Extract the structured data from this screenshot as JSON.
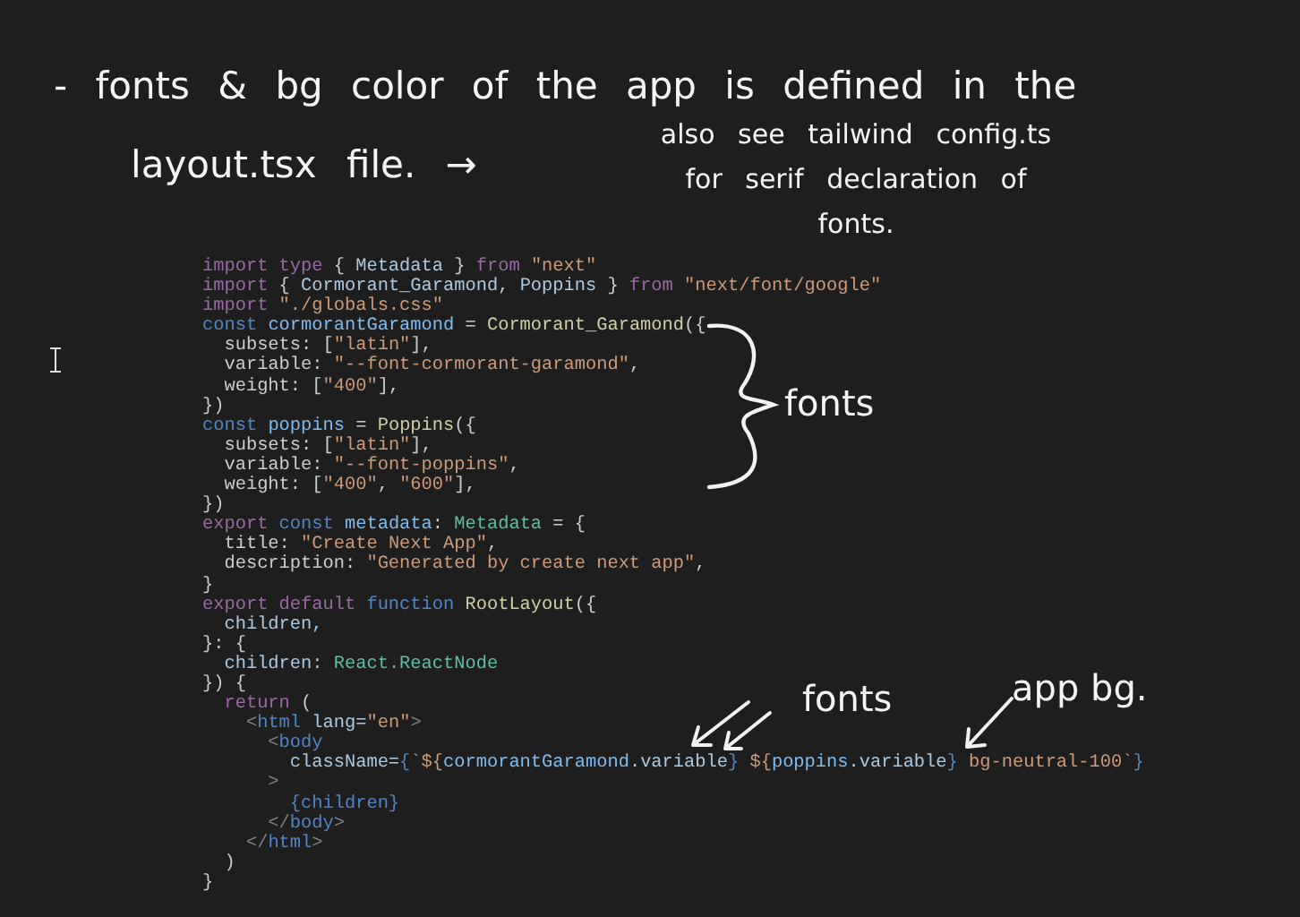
{
  "note": {
    "line1": "- fonts & bg color of the app is defined in the",
    "line2": "layout.tsx file. →",
    "aside": [
      "also see tailwind config.ts",
      "for serif declaration of",
      "fonts."
    ]
  },
  "code": {
    "lines": [
      [
        {
          "t": "import type",
          "kind": "kw"
        },
        {
          "t": " { ",
          "kind": "p"
        },
        {
          "t": "Metadata",
          "kind": "var"
        },
        {
          "t": " } ",
          "kind": "p"
        },
        {
          "t": "from",
          "kind": "kw"
        },
        {
          "t": " \"next\"",
          "kind": "str"
        }
      ],
      [
        {
          "t": "import",
          "kind": "kw"
        },
        {
          "t": " { ",
          "kind": "p"
        },
        {
          "t": "Cormorant_Garamond",
          "kind": "var"
        },
        {
          "t": ", ",
          "kind": "p"
        },
        {
          "t": "Poppins",
          "kind": "var"
        },
        {
          "t": " } ",
          "kind": "p"
        },
        {
          "t": "from",
          "kind": "kw"
        },
        {
          "t": " \"next/font/google\"",
          "kind": "str"
        }
      ],
      [
        {
          "t": "import",
          "kind": "kw"
        },
        {
          "t": " \"./globals.css\"",
          "kind": "str"
        }
      ],
      [
        {
          "t": "const",
          "kind": "decl"
        },
        {
          "t": " cormorantGaramond",
          "kind": "varb"
        },
        {
          "t": " = ",
          "kind": "p"
        },
        {
          "t": "Cormorant_Garamond",
          "kind": "fn"
        },
        {
          "t": "({",
          "kind": "p"
        }
      ],
      [
        {
          "t": "  subsets: [",
          "kind": "p"
        },
        {
          "t": "\"latin\"",
          "kind": "str"
        },
        {
          "t": "],",
          "kind": "p"
        }
      ],
      [
        {
          "t": "  variable: ",
          "kind": "p"
        },
        {
          "t": "\"--font-cormorant-garamond\"",
          "kind": "str"
        },
        {
          "t": ",",
          "kind": "p"
        }
      ],
      [
        {
          "t": "  weight: [",
          "kind": "p"
        },
        {
          "t": "\"400\"",
          "kind": "str"
        },
        {
          "t": "],",
          "kind": "p"
        }
      ],
      [
        {
          "t": "})",
          "kind": "p"
        }
      ],
      [
        {
          "t": "const",
          "kind": "decl"
        },
        {
          "t": " poppins",
          "kind": "varb"
        },
        {
          "t": " = ",
          "kind": "p"
        },
        {
          "t": "Poppins",
          "kind": "fn"
        },
        {
          "t": "({",
          "kind": "p"
        }
      ],
      [
        {
          "t": "  subsets: [",
          "kind": "p"
        },
        {
          "t": "\"latin\"",
          "kind": "str"
        },
        {
          "t": "],",
          "kind": "p"
        }
      ],
      [
        {
          "t": "  variable: ",
          "kind": "p"
        },
        {
          "t": "\"--font-poppins\"",
          "kind": "str"
        },
        {
          "t": ",",
          "kind": "p"
        }
      ],
      [
        {
          "t": "  weight: [",
          "kind": "p"
        },
        {
          "t": "\"400\"",
          "kind": "str"
        },
        {
          "t": ", ",
          "kind": "p"
        },
        {
          "t": "\"600\"",
          "kind": "str"
        },
        {
          "t": "],",
          "kind": "p"
        }
      ],
      [
        {
          "t": "})",
          "kind": "p"
        }
      ],
      [
        {
          "t": "export",
          "kind": "kw"
        },
        {
          "t": " const",
          "kind": "decl"
        },
        {
          "t": " metadata",
          "kind": "varb"
        },
        {
          "t": ": ",
          "kind": "p"
        },
        {
          "t": "Metadata",
          "kind": "type"
        },
        {
          "t": " = {",
          "kind": "p"
        }
      ],
      [
        {
          "t": "  title: ",
          "kind": "p"
        },
        {
          "t": "\"Create Next App\"",
          "kind": "str"
        },
        {
          "t": ",",
          "kind": "p"
        }
      ],
      [
        {
          "t": "  description: ",
          "kind": "p"
        },
        {
          "t": "\"Generated by create next app\"",
          "kind": "str"
        },
        {
          "t": ",",
          "kind": "p"
        }
      ],
      [
        {
          "t": "}",
          "kind": "p"
        }
      ],
      [
        {
          "t": "export default",
          "kind": "kw"
        },
        {
          "t": " function",
          "kind": "decl"
        },
        {
          "t": " RootLayout",
          "kind": "fn"
        },
        {
          "t": "({",
          "kind": "p"
        }
      ],
      [
        {
          "t": "  children,",
          "kind": "var"
        }
      ],
      [
        {
          "t": "}: {",
          "kind": "p"
        }
      ],
      [
        {
          "t": "  children: ",
          "kind": "var"
        },
        {
          "t": "React.ReactNode",
          "kind": "type"
        }
      ],
      [
        {
          "t": "}) {",
          "kind": "p"
        }
      ],
      [
        {
          "t": "  return",
          "kind": "kw"
        },
        {
          "t": " (",
          "kind": "p"
        }
      ],
      [
        {
          "t": "    <",
          "kind": "punct"
        },
        {
          "t": "html",
          "kind": "decl"
        },
        {
          "t": " lang=",
          "kind": "var"
        },
        {
          "t": "\"en\"",
          "kind": "str"
        },
        {
          "t": ">",
          "kind": "punct"
        }
      ],
      [
        {
          "t": "      <",
          "kind": "punct"
        },
        {
          "t": "body",
          "kind": "decl"
        }
      ],
      [
        {
          "t": "        className=",
          "kind": "var"
        },
        {
          "t": "{",
          "kind": "decl"
        },
        {
          "t": "`${",
          "kind": "str"
        },
        {
          "t": "cormorantGaramond",
          "kind": "varb"
        },
        {
          "t": ".variable",
          "kind": "var"
        },
        {
          "t": "}",
          "kind": "decl"
        },
        {
          "t": " ${",
          "kind": "str"
        },
        {
          "t": "poppins",
          "kind": "varb"
        },
        {
          "t": ".variable",
          "kind": "var"
        },
        {
          "t": "}",
          "kind": "decl"
        },
        {
          "t": " bg-neutral-100`",
          "kind": "str"
        },
        {
          "t": "}",
          "kind": "decl"
        }
      ],
      [
        {
          "t": "      >",
          "kind": "punct"
        }
      ],
      [
        {
          "t": "        {children}",
          "kind": "decl"
        }
      ],
      [
        {
          "t": "      </",
          "kind": "punct"
        },
        {
          "t": "body",
          "kind": "decl"
        },
        {
          "t": ">",
          "kind": "punct"
        }
      ],
      [
        {
          "t": "    </",
          "kind": "punct"
        },
        {
          "t": "html",
          "kind": "decl"
        },
        {
          "t": ">",
          "kind": "punct"
        }
      ],
      [
        {
          "t": "  )",
          "kind": "p"
        }
      ],
      [
        {
          "t": "}",
          "kind": "p"
        }
      ]
    ]
  },
  "annotations": [
    {
      "kind": "brace",
      "label": "fonts"
    },
    {
      "kind": "double-arrow",
      "label": "fonts"
    },
    {
      "kind": "arrow",
      "label": "app bg."
    }
  ]
}
